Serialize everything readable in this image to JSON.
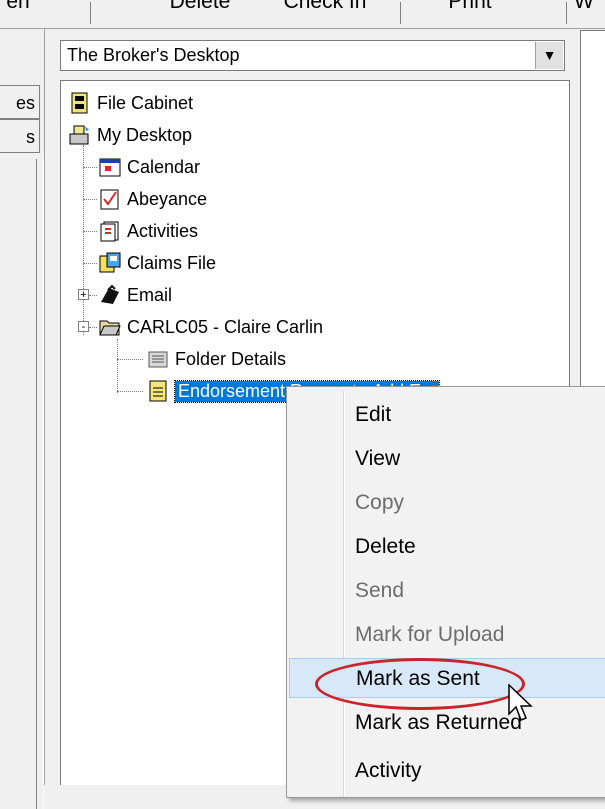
{
  "toolbar": {
    "items": [
      {
        "label": "en"
      },
      {
        "label": "Delete"
      },
      {
        "label": "Check In"
      },
      {
        "label": "Print"
      },
      {
        "label": "W"
      }
    ]
  },
  "side_tabs": [
    "es",
    "s"
  ],
  "dropdown": {
    "value": "The Broker's Desktop"
  },
  "tree": {
    "nodes": [
      {
        "label": "File Cabinet",
        "icon": "file-cabinet-icon"
      },
      {
        "label": "My Desktop",
        "icon": "desktop-icon"
      },
      {
        "label": "Calendar",
        "icon": "calendar-icon"
      },
      {
        "label": "Abeyance",
        "icon": "checklist-icon"
      },
      {
        "label": "Activities",
        "icon": "activities-icon"
      },
      {
        "label": "Claims File",
        "icon": "claims-file-icon"
      },
      {
        "label": "Email",
        "icon": "email-icon",
        "expander": "+"
      },
      {
        "label": "CARLC05 - Claire Carlin",
        "icon": "open-folder-icon",
        "expander": "-"
      },
      {
        "label": "Folder Details",
        "icon": "folder-details-icon"
      },
      {
        "label": "Endorsement Request - Add E...",
        "icon": "document-icon",
        "selected": true
      }
    ]
  },
  "context_menu": {
    "items": [
      {
        "label": "Edit",
        "enabled": true
      },
      {
        "label": "View",
        "enabled": true
      },
      {
        "label": "Copy",
        "enabled": false
      },
      {
        "label": "Delete",
        "enabled": true
      },
      {
        "label": "Send",
        "enabled": false
      },
      {
        "label": "Mark for Upload",
        "enabled": false
      },
      {
        "label": "Mark as  Sent",
        "enabled": true,
        "hovered": true
      },
      {
        "label": "Mark as Returned",
        "enabled": true
      },
      {
        "label": "Activity",
        "enabled": true
      }
    ]
  },
  "colors": {
    "selection": "#0078d7",
    "highlight_ring": "#c8242a",
    "menu_hover": "#d7e8f8"
  }
}
